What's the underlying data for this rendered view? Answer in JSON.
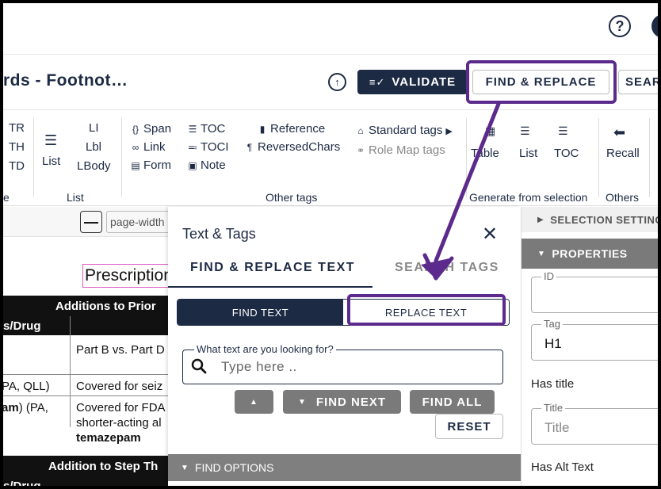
{
  "header": {
    "doc_title": "rds - Footnot…",
    "validate_label": "VALIDATE",
    "find_replace_label": "FIND & REPLACE",
    "search_label": "SEAR",
    "help_glyph": "?",
    "upload_glyph": "↑"
  },
  "ribbon": {
    "col_table": [
      "TR",
      "TH",
      "TD"
    ],
    "group_partial": "e",
    "list_btn": "List",
    "list_items": [
      "LI",
      "Lbl",
      "LBody"
    ],
    "group_list": "List",
    "other_col1": [
      "Span",
      "Link",
      "Form"
    ],
    "other_col2": [
      "TOC",
      "TOCI",
      "Note"
    ],
    "other_col3": [
      "Reference",
      "ReversedChars"
    ],
    "standard_tags": "Standard tags",
    "role_map_tags": "Role Map tags",
    "group_other": "Other tags",
    "gen_items": [
      "Table",
      "List",
      "TOC"
    ],
    "group_gen": "Generate from selection",
    "recall": "Recall",
    "group_others": "Others"
  },
  "doc": {
    "zoom_minus": "—",
    "zoom_value": "page-width",
    "title_text": "Prescription",
    "table1_header": "Additions to Prior",
    "table1_sub": "s/Drug",
    "row1": "Part B vs. Part D",
    "row2_left": "PA, QLL)",
    "row2_right": "Covered for seiz",
    "row3_left_bold": "am",
    "row3_left_rest": ") (PA,",
    "row3_right_1": "Covered for FDA",
    "row3_right_2": "shorter-acting al",
    "row3_right_3": "temazepam",
    "table2_header": "Addition to Step Th",
    "table2_sub": "s/Drug"
  },
  "dialog": {
    "title": "Text & Tags",
    "close_glyph": "✕",
    "tab_find_replace": "FIND & REPLACE TEXT",
    "tab_search_tags": "SEARCH TAGS",
    "seg_find": "FIND TEXT",
    "seg_replace": "REPLACE TEXT",
    "search_label": "What text are you looking for?",
    "search_placeholder": "Type here ..",
    "btn_prev": "▲",
    "btn_find_next": "FIND NEXT",
    "btn_find_all": "FIND ALL",
    "btn_reset": "RESET",
    "find_options": "FIND OPTIONS"
  },
  "right_panel": {
    "selection_settings": "SELECTION SETTINGS",
    "properties": "PROPERTIES",
    "id_label": "ID",
    "id_value": "",
    "tag_label": "Tag",
    "tag_value": "H1",
    "has_title": "Has title",
    "title_label": "Title",
    "title_placeholder": "Title",
    "has_alt_text": "Has Alt Text"
  },
  "colors": {
    "navy": "#1d2a44",
    "annotation_purple": "#5c2a8c",
    "grey_button": "#7a7a7a"
  }
}
